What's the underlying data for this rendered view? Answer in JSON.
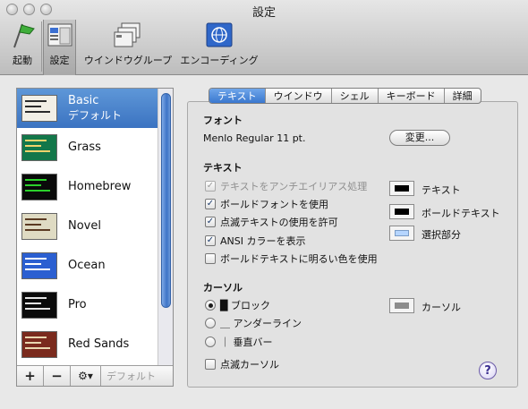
{
  "window": {
    "title": "設定"
  },
  "toolbar": {
    "items": [
      {
        "label": "起動",
        "icon": "startup-flag-icon"
      },
      {
        "label": "設定",
        "icon": "settings-window-icon"
      },
      {
        "label": "ウインドウグループ",
        "icon": "window-group-icon"
      },
      {
        "label": "エンコーディング",
        "icon": "encoding-globe-icon"
      }
    ]
  },
  "profiles": {
    "items": [
      {
        "name": "Basic",
        "sub": "デフォルト",
        "thumb_bg": "#f2efe6",
        "thumb_fg": "#2b2b2b"
      },
      {
        "name": "Grass",
        "thumb_bg": "#13774a",
        "thumb_fg": "#f2d36b"
      },
      {
        "name": "Homebrew",
        "thumb_bg": "#0a0a0a",
        "thumb_fg": "#2bd12b"
      },
      {
        "name": "Novel",
        "thumb_bg": "#dfdbc3",
        "thumb_fg": "#5a3a22"
      },
      {
        "name": "Ocean",
        "thumb_bg": "#2b5fd1",
        "thumb_fg": "#ffffff"
      },
      {
        "name": "Pro",
        "thumb_bg": "#0b0b0b",
        "thumb_fg": "#e6e6e6"
      },
      {
        "name": "Red Sands",
        "thumb_bg": "#7a2a1d",
        "thumb_fg": "#e9d7b0"
      }
    ],
    "add_label": "+",
    "remove_label": "−",
    "gear_label": "⚙▾",
    "default_label": "デフォルト"
  },
  "tabs": [
    {
      "label": "テキスト",
      "active": true
    },
    {
      "label": "ウインドウ"
    },
    {
      "label": "シェル"
    },
    {
      "label": "キーボード"
    },
    {
      "label": "詳細"
    }
  ],
  "font_section": {
    "heading": "フォント",
    "value": "Menlo Regular 11 pt.",
    "change_button": "変更..."
  },
  "text_section": {
    "heading": "テキスト",
    "antialias": {
      "label": "テキストをアンチエイリアス処理",
      "checked": true,
      "disabled": true
    },
    "bold_font": {
      "label": "ボールドフォントを使用",
      "checked": true
    },
    "blink_text": {
      "label": "点滅テキストの使用を許可",
      "checked": true
    },
    "ansi_color": {
      "label": "ANSI カラーを表示",
      "checked": true
    },
    "bright_bold": {
      "label": "ボールドテキストに明るい色を使用",
      "checked": false
    },
    "colors": [
      {
        "label": "テキスト",
        "color": "#000000"
      },
      {
        "label": "ボールドテキスト",
        "color": "#000000"
      },
      {
        "label": "選択部分",
        "color": "#b5d5ff"
      }
    ]
  },
  "cursor_section": {
    "heading": "カーソル",
    "options": [
      {
        "label": "█ ブロック",
        "selected": true
      },
      {
        "label": "＿ アンダーライン",
        "selected": false
      },
      {
        "label": "｜ 垂直バー",
        "selected": false
      }
    ],
    "blink": {
      "label": "点滅カーソル",
      "checked": false
    },
    "color": {
      "label": "カーソル",
      "color": "#8c8c8c"
    }
  },
  "help_label": "?"
}
